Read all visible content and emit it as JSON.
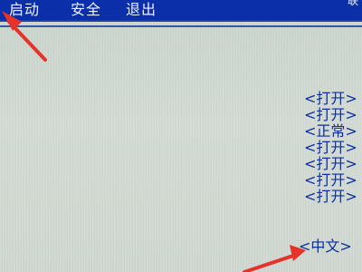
{
  "menubar": {
    "items": [
      {
        "label": "启动"
      },
      {
        "label": "安全"
      },
      {
        "label": "退出"
      }
    ],
    "corner_fragment": "联"
  },
  "values": [
    "<打开>",
    "<打开>",
    "<正常>",
    "<打开>",
    "<打开>",
    "<打开>",
    "<打开>"
  ],
  "language": "<中文>",
  "colors": {
    "menubar": "#0a2fa8",
    "text_blue": "#0b2f9d",
    "arrow_red": "#e5332a",
    "background": "#cdd6cf"
  }
}
